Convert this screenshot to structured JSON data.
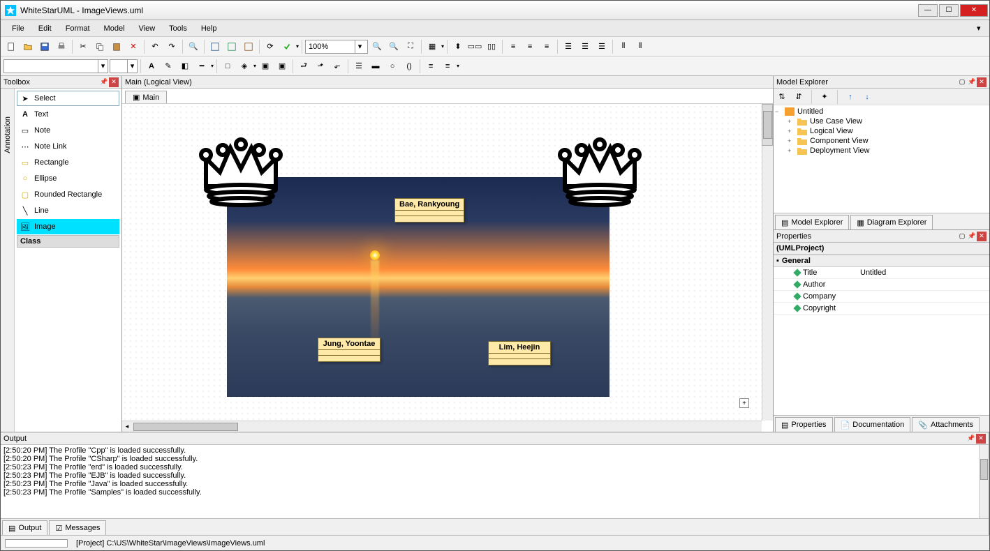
{
  "title": "WhiteStarUML - ImageViews.uml",
  "menu": [
    "File",
    "Edit",
    "Format",
    "Model",
    "View",
    "Tools",
    "Help"
  ],
  "zoom": "100%",
  "toolbox": {
    "title": "Toolbox",
    "group": "Annotation",
    "items": [
      "Select",
      "Text",
      "Note",
      "Note Link",
      "Rectangle",
      "Ellipse",
      "Rounded Rectangle",
      "Line",
      "Image"
    ],
    "active": "Image",
    "class_group": "Class"
  },
  "diagram": {
    "tab_header": "Main (Logical View)",
    "subtab": "Main",
    "classes": {
      "top": "Bae, Rankyoung",
      "left": "Jung, Yoontae",
      "right": "Lim, Heejin"
    }
  },
  "model_explorer": {
    "title": "Model Explorer",
    "root": "Untitled",
    "children": [
      "Use Case View",
      "Logical View",
      "Component View",
      "Deployment View"
    ],
    "tabs": [
      "Model Explorer",
      "Diagram Explorer"
    ]
  },
  "properties": {
    "title": "Properties",
    "header": "(UMLProject)",
    "category": "General",
    "rows": [
      {
        "k": "Title",
        "v": "Untitled"
      },
      {
        "k": "Author",
        "v": ""
      },
      {
        "k": "Company",
        "v": ""
      },
      {
        "k": "Copyright",
        "v": ""
      }
    ],
    "tabs": [
      "Properties",
      "Documentation",
      "Attachments"
    ]
  },
  "output": {
    "title": "Output",
    "lines": [
      "[2:50:20 PM]   The Profile \"Cpp\" is loaded successfully.",
      "[2:50:20 PM]   The Profile \"CSharp\" is loaded successfully.",
      "[2:50:23 PM]   The Profile \"erd\" is loaded successfully.",
      "[2:50:23 PM]   The Profile \"EJB\" is loaded successfully.",
      "[2:50:23 PM]   The Profile \"Java\" is loaded successfully.",
      "[2:50:23 PM]   The Profile \"Samples\" is loaded successfully."
    ],
    "tabs": [
      "Output",
      "Messages"
    ]
  },
  "status": "[Project] C:\\US\\WhiteStar\\ImageViews\\ImageViews.uml"
}
